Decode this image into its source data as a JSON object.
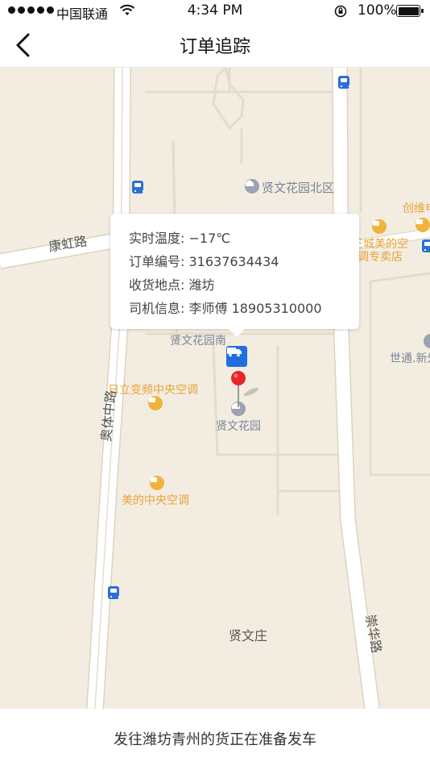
{
  "status_bar": {
    "carrier": "中国联通",
    "time": "4:34 PM",
    "battery_percent": "100%",
    "battery_level": 1.0
  },
  "nav": {
    "title": "订单追踪",
    "back_icon": "chevron-left-icon"
  },
  "map": {
    "roads": {
      "kanghong": "康虹路",
      "aoti": "奥体中路",
      "chonghua": "崇华路"
    },
    "places": {
      "xianwen_north": "贤文花园北区",
      "xianwen_south": "贤文花园南",
      "xianwen_garden": "贤文花园",
      "xianwen_village": "贤文庄",
      "hitachi": "日立变频中央空调",
      "midea": "美的中央空调",
      "chuangwei": "创维电",
      "midea_store_1": "王城美的空",
      "midea_store_2": "调专卖店",
      "shitong": "世通.新外",
      "hidden_red": "贤文花园"
    }
  },
  "info_bubble": {
    "temperature": "实时温度: −17℃",
    "order_no": "订单编号: 31637634434",
    "delivery_place": "收货地点: 潍坊",
    "driver": "司机信息: 李师傅  18905310000"
  },
  "footer": {
    "message": "发往潍坊青州的货正在准备发车"
  },
  "colors": {
    "map_bg": "#f3ede1",
    "road": "#ffffff",
    "truck_marker": "#1f6fe0",
    "pin": "#e8262a",
    "poi_orange": "#e8a23a",
    "poi_gray": "#7a8597",
    "bus": "#2a6fd8"
  }
}
